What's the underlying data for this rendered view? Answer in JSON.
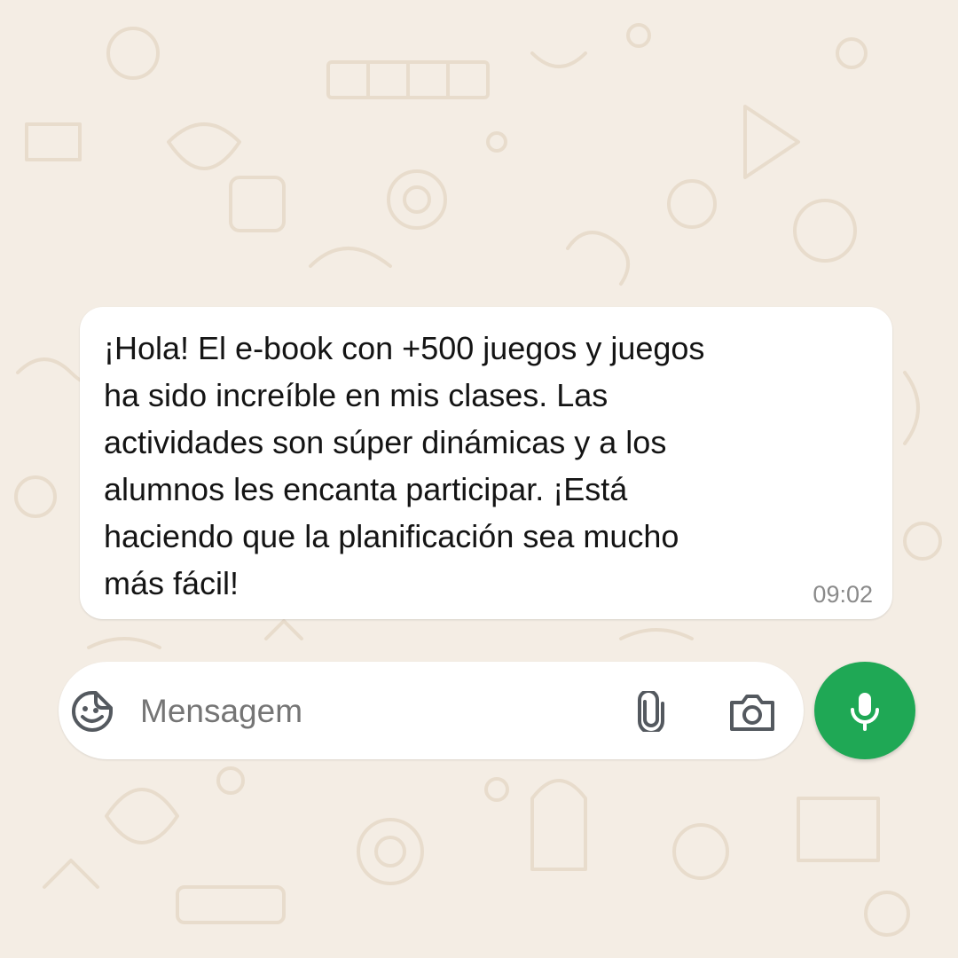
{
  "message": {
    "lines": [
      "¡Hola! El e-book con +500 juegos y juegos",
      "ha sido increíble en mis clases. Las",
      "actividades son súper dinámicas y a los",
      "alumnos les encanta participar. ¡Está",
      "haciendo que la planificación sea mucho",
      "más fácil!"
    ],
    "time": "09:02"
  },
  "composer": {
    "placeholder": "Mensagem",
    "sticker_icon": "sticker-icon",
    "attach_icon": "paperclip-icon",
    "camera_icon": "camera-icon"
  },
  "mic": {
    "icon": "microphone-icon",
    "color": "#1fa855"
  },
  "theme": {
    "background": "#f4ede4",
    "bubble": "#ffffff"
  }
}
